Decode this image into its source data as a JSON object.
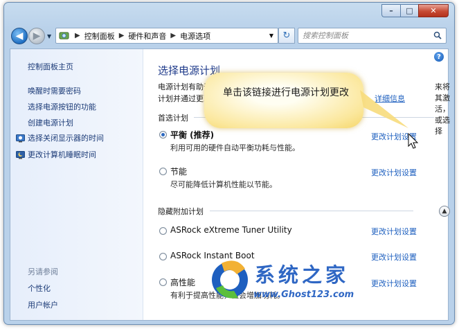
{
  "window": {
    "min_label": "–",
    "max_label": "□",
    "close_label": "✕"
  },
  "nav": {
    "breadcrumb": [
      "控制面板",
      "硬件和声音",
      "电源选项"
    ],
    "search_placeholder": "搜索控制面板"
  },
  "sidebar": {
    "home": "控制面板主页",
    "links": [
      "唤醒时需要密码",
      "选择电源按钮的功能",
      "创建电源计划"
    ],
    "icon_links": [
      "选择关闭显示器的时间",
      "更改计算机睡眠时间"
    ],
    "see_also_head": "另请参阅",
    "see_also": [
      "个性化",
      "用户帐户"
    ]
  },
  "main": {
    "title": "选择电源计划",
    "desc_line1": "电源计划有助于",
    "desc_line2": "计划并通过更改",
    "desc_right": "来将其激活，或选择",
    "desc_link": "详细信息",
    "preferred_head": "首选计划",
    "hidden_head": "隐藏附加计划",
    "change_link": "更改计划设置",
    "plans_preferred": [
      {
        "name": "平衡 (推荐)",
        "desc": "利用可用的硬件自动平衡功耗与性能。",
        "selected": true
      },
      {
        "name": "节能",
        "desc": "尽可能降低计算机性能以节能。",
        "selected": false
      }
    ],
    "plans_hidden": [
      {
        "name": "ASRock eXtreme Tuner Utility",
        "desc": ""
      },
      {
        "name": "ASRock Instant Boot",
        "desc": ""
      },
      {
        "name": "高性能",
        "desc": "有利于提高性能，但会增加功耗。"
      }
    ]
  },
  "callout": {
    "text": "单击该链接进行电源计划更改"
  },
  "watermark": {
    "title": "系统之家",
    "url": "www.Ghost123.com"
  },
  "colors": {
    "link": "#1d5fbf",
    "title": "#1e3a8a",
    "callout": "#fbe79b"
  }
}
